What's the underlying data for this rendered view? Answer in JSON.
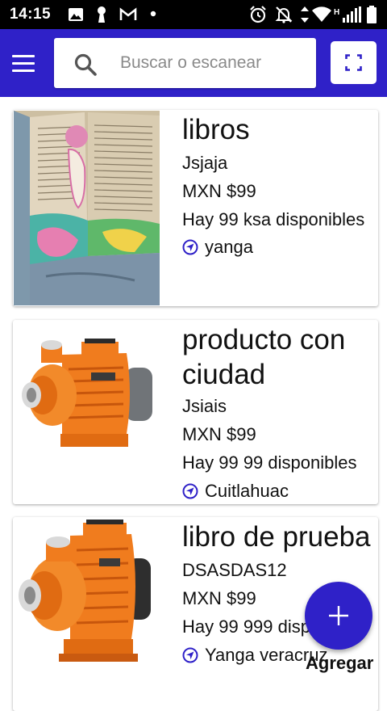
{
  "status_bar": {
    "time": "14:15",
    "network_label": "H"
  },
  "search": {
    "placeholder": "Buscar o escanear"
  },
  "products": [
    {
      "title": "libros",
      "code": "Jsjaja",
      "price": "MXN $99",
      "stock": "Hay 99 ksa disponibles",
      "location": "yanga"
    },
    {
      "title": "producto con ciudad",
      "code": "Jsiais",
      "price": "MXN $99",
      "stock": "Hay 99 99 disponibles",
      "location": "Cuitlahuac"
    },
    {
      "title": "libro de prueba",
      "code": "DSASDAS12",
      "price": "MXN $99",
      "stock": "Hay 99 999 disponibles",
      "location": "Yanga veracruz"
    }
  ],
  "fab": {
    "label": "Agregar",
    "icon": "plus-icon"
  },
  "colors": {
    "appbar": "#2f21c8",
    "accent": "#2f21c8",
    "pump_orange": "#f07c1e"
  }
}
